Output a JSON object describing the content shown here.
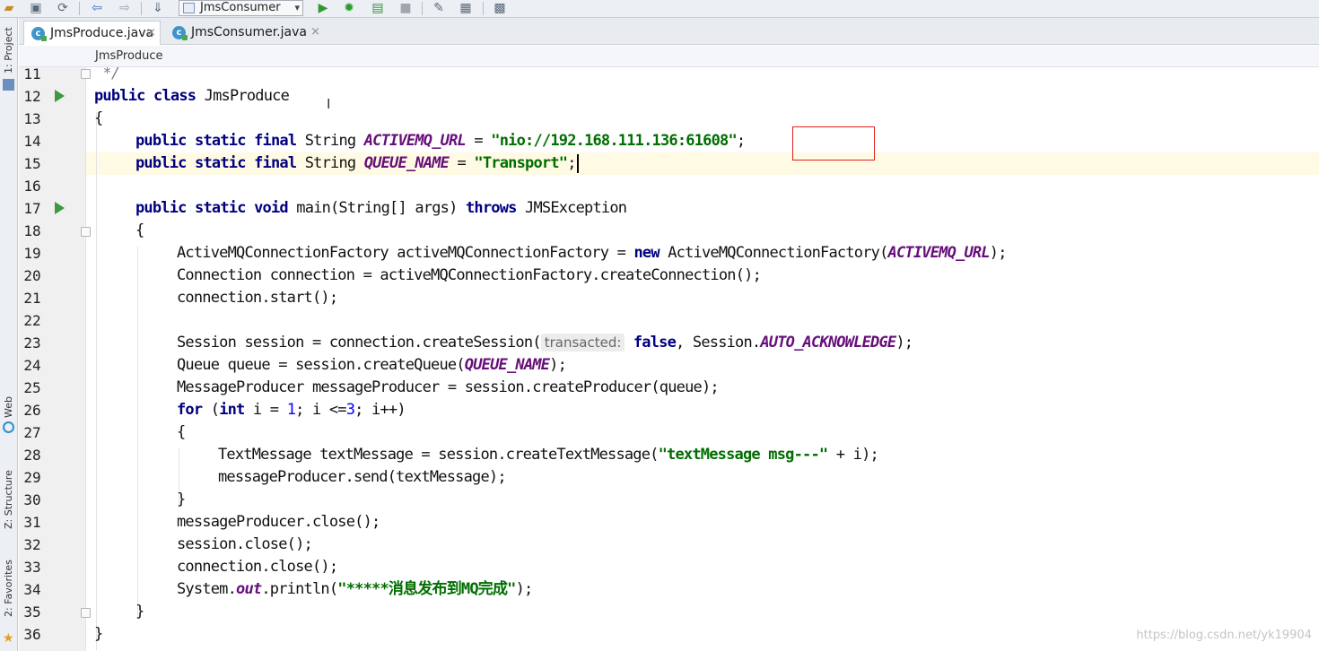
{
  "toolbar": {
    "run_config": "JmsConsumer",
    "icons": [
      "open-folder-icon",
      "save-icon",
      "sync-icon",
      "back-icon",
      "forward-icon",
      "build-icon",
      "run-icon",
      "debug-icon",
      "coverage-icon",
      "stop-icon",
      "project-structure-icon",
      "settings-icon",
      "sdk-icon"
    ]
  },
  "side_panel": {
    "project_label": "1: Project",
    "web_label": "Web",
    "structure_label": "Z: Structure",
    "favorites_label": "2: Favorites"
  },
  "tabs": [
    {
      "label": "JmsProduce.java",
      "active": true
    },
    {
      "label": "JmsConsumer.java",
      "active": false
    }
  ],
  "tab_close_glyph": "×",
  "breadcrumb": "JmsProduce",
  "code": {
    "line_numbers": [
      "11",
      "12",
      "13",
      "14",
      "15",
      "16",
      "17",
      "18",
      "19",
      "20",
      "21",
      "22",
      "23",
      "24",
      "25",
      "26",
      "27",
      "28",
      "29",
      "30",
      "31",
      "32",
      "33",
      "34",
      "35",
      "36"
    ],
    "l11": " */",
    "l12_kw": "public class",
    "l12_name": " JmsProduce",
    "l13": "{",
    "l14_kw": "public static final",
    "l14_type": " String ",
    "l14_const": "ACTIVEMQ_URL",
    "l14_eq": " = ",
    "l14_str": "\"nio://192.168.111.136:61608\"",
    "l14_end": ";",
    "l15_kw": "public static final",
    "l15_type": " String ",
    "l15_const": "QUEUE_NAME",
    "l15_eq": " = ",
    "l15_str": "\"Transport\"",
    "l15_end": ";",
    "l17_kw": "public static void",
    "l17_mid": " main(String[] args) ",
    "l17_kw2": "throws",
    "l17_end": " JMSException",
    "l18": "{",
    "l19_a": "ActiveMQConnectionFactory activeMQConnectionFactory = ",
    "l19_kw": "new",
    "l19_b": " ActiveMQConnectionFactory(",
    "l19_const": "ACTIVEMQ_URL",
    "l19_end": ");",
    "l20": "Connection connection = activeMQConnectionFactory.createConnection();",
    "l21": "connection.start();",
    "l23_a": "Session session = connection.createSession(",
    "l23_hint": "transacted:",
    "l23_kw": "false",
    "l23_b": ", Session.",
    "l23_const": "AUTO_ACKNOWLEDGE",
    "l23_end": ");",
    "l24_a": "Queue queue = session.createQueue(",
    "l24_const": "QUEUE_NAME",
    "l24_end": ");",
    "l25": "MessageProducer messageProducer = session.createProducer(queue);",
    "l26_kw": "for",
    "l26_a": " (",
    "l26_kw2": "int",
    "l26_b": " i = ",
    "l26_n1": "1",
    "l26_c": "; i <=",
    "l26_n2": "3",
    "l26_d": "; i++)",
    "l27": "{",
    "l28_a": "TextMessage textMessage = session.createTextMessage(",
    "l28_str": "\"textMessage msg---\"",
    "l28_end": " + i);",
    "l29": "messageProducer.send(textMessage);",
    "l30": "}",
    "l31": "messageProducer.close();",
    "l32": "session.close();",
    "l33": "connection.close();",
    "l34_a": "System.",
    "l34_out": "out",
    "l34_b": ".println(",
    "l34_str": "\"*****消息发布到MQ完成\"",
    "l34_end": ");",
    "l35": "}",
    "l36": "}"
  },
  "watermark": "https://blog.csdn.net/yk19904"
}
